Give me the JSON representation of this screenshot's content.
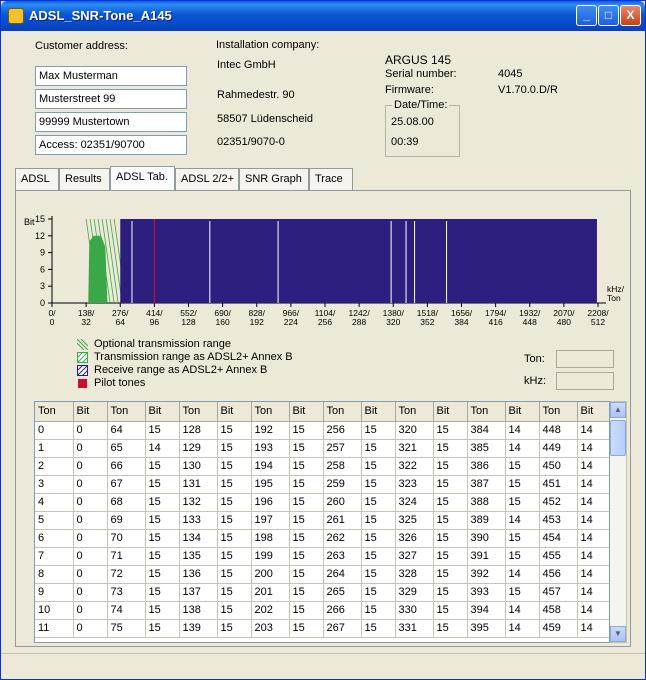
{
  "window": {
    "title": "ADSL_SNR-Tone_A145"
  },
  "titlebar_buttons": {
    "minimize": "_",
    "maximize": "□",
    "close": "X"
  },
  "customer": {
    "legend": "Customer address:",
    "name": "Max Musterman",
    "street": "Musterstreet 99",
    "city": "99999 Mustertown",
    "access": "Access: 02351/90700"
  },
  "installer": {
    "legend": "Installation company:",
    "name": "Intec GmbH",
    "street": "Rahmedestr. 90",
    "city": "58507 Lüdenscheid",
    "phone": "02351/9070-0"
  },
  "device": {
    "model": "ARGUS 145",
    "serial_label": "Serial number:",
    "serial_value": "4045",
    "firmware_label": "Firmware:",
    "firmware_value": "V1.70.0.D/R",
    "datetime_legend": "Date/Time:",
    "date": "25.08.00",
    "time": "00:39"
  },
  "tabs": [
    {
      "label": "ADSL",
      "active": false
    },
    {
      "label": "Results",
      "active": false
    },
    {
      "label": "ADSL Tab.",
      "active": true
    },
    {
      "label": "ADSL 2/2+",
      "active": false
    },
    {
      "label": "SNR Graph",
      "active": false
    },
    {
      "label": "Trace",
      "active": false
    }
  ],
  "chart_data": {
    "type": "bar",
    "ylabel": "Bit",
    "x_unit": "kHz/ Ton",
    "ylim": [
      0,
      15
    ],
    "y_ticks": [
      "15",
      "12",
      "9",
      "6",
      "3",
      "0"
    ],
    "x_ticks_khz": [
      "0/",
      "138/",
      "276/",
      "414/",
      "552/",
      "690/",
      "828/",
      "966/",
      "1104/",
      "1242/",
      "1380/",
      "1518/",
      "1656/",
      "1794/",
      "1932/",
      "2070/",
      "2208/"
    ],
    "x_ticks_ton": [
      "0",
      "32",
      "64",
      "96",
      "128",
      "160",
      "192",
      "224",
      "256",
      "288",
      "320",
      "352",
      "384",
      "416",
      "448",
      "480",
      "512"
    ],
    "upstream_tone_range": [
      32,
      63
    ],
    "downstream_tone_range": [
      64,
      511
    ],
    "pilot_tone": 96,
    "colors": {
      "upstream": "#3aa848",
      "downstream": "#2b1e7e",
      "pilot": "#c8102e",
      "optional_hatch": "#3aa848"
    }
  },
  "legend": [
    {
      "label": "Optional transmission range",
      "icon": "diagonal-lines-icon"
    },
    {
      "label": "Transmission range as ADSL2+ Annex B",
      "icon": "green-hatched-box-icon"
    },
    {
      "label": "Receive range as ADSL2+ Annex B",
      "icon": "blue-hatched-box-icon"
    },
    {
      "label": "Pilot tones",
      "icon": "red-square-icon"
    }
  ],
  "readout": {
    "ton_label": "Ton:",
    "khz_label": "kHz:"
  },
  "table": {
    "headers": [
      "Ton",
      "Bit",
      "Ton",
      "Bit",
      "Ton",
      "Bit",
      "Ton",
      "Bit",
      "Ton",
      "Bit",
      "Ton",
      "Bit",
      "Ton",
      "Bit",
      "Ton",
      "Bit"
    ],
    "rows": [
      [
        "0",
        "0",
        "64",
        "15",
        "128",
        "15",
        "192",
        "15",
        "256",
        "15",
        "320",
        "15",
        "384",
        "14",
        "448",
        "14"
      ],
      [
        "1",
        "0",
        "65",
        "14",
        "129",
        "15",
        "193",
        "15",
        "257",
        "15",
        "321",
        "15",
        "385",
        "14",
        "449",
        "14"
      ],
      [
        "2",
        "0",
        "66",
        "15",
        "130",
        "15",
        "194",
        "15",
        "258",
        "15",
        "322",
        "15",
        "386",
        "15",
        "450",
        "14"
      ],
      [
        "3",
        "0",
        "67",
        "15",
        "131",
        "15",
        "195",
        "15",
        "259",
        "15",
        "323",
        "15",
        "387",
        "15",
        "451",
        "14"
      ],
      [
        "4",
        "0",
        "68",
        "15",
        "132",
        "15",
        "196",
        "15",
        "260",
        "15",
        "324",
        "15",
        "388",
        "15",
        "452",
        "14"
      ],
      [
        "5",
        "0",
        "69",
        "15",
        "133",
        "15",
        "197",
        "15",
        "261",
        "15",
        "325",
        "15",
        "389",
        "14",
        "453",
        "14"
      ],
      [
        "6",
        "0",
        "70",
        "15",
        "134",
        "15",
        "198",
        "15",
        "262",
        "15",
        "326",
        "15",
        "390",
        "15",
        "454",
        "14"
      ],
      [
        "7",
        "0",
        "71",
        "15",
        "135",
        "15",
        "199",
        "15",
        "263",
        "15",
        "327",
        "15",
        "391",
        "15",
        "455",
        "14"
      ],
      [
        "8",
        "0",
        "72",
        "15",
        "136",
        "15",
        "200",
        "15",
        "264",
        "15",
        "328",
        "15",
        "392",
        "14",
        "456",
        "14"
      ],
      [
        "9",
        "0",
        "73",
        "15",
        "137",
        "15",
        "201",
        "15",
        "265",
        "15",
        "329",
        "15",
        "393",
        "15",
        "457",
        "14"
      ],
      [
        "10",
        "0",
        "74",
        "15",
        "138",
        "15",
        "202",
        "15",
        "266",
        "15",
        "330",
        "15",
        "394",
        "14",
        "458",
        "14"
      ],
      [
        "11",
        "0",
        "75",
        "15",
        "139",
        "15",
        "203",
        "15",
        "267",
        "15",
        "331",
        "15",
        "395",
        "14",
        "459",
        "14"
      ]
    ]
  },
  "scrollbar": {
    "up": "▲",
    "down": "▼"
  }
}
